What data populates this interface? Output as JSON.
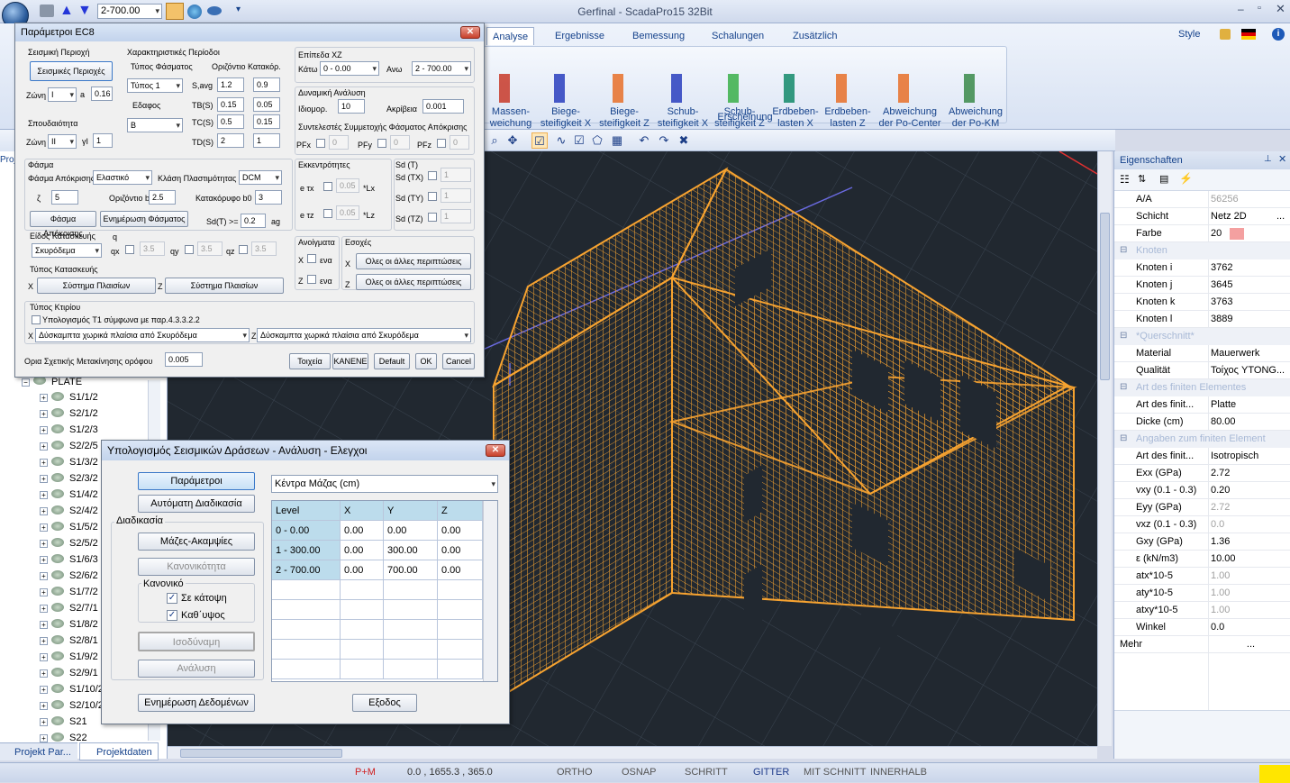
{
  "window": {
    "title": "Gerfinal - ScadaPro15 32Bit",
    "quick_value": "2-700.00"
  },
  "ribbon": {
    "tabs": [
      "Analyse",
      "Ergebnisse",
      "Bemessung",
      "Schalungen",
      "Zusätzlich"
    ],
    "style_label": "Style",
    "group_label": "Erscheinung",
    "buttons": [
      {
        "line1": "Massen-",
        "line2": "weichung"
      },
      {
        "line1": "Biege-",
        "line2": "steifigkeit X"
      },
      {
        "line1": "Biege-",
        "line2": "steifigkeit Z"
      },
      {
        "line1": "Schub-",
        "line2": "steifigkeit X"
      },
      {
        "line1": "Schub-",
        "line2": "steifigkeit Z"
      },
      {
        "line1": "Erdbeben-",
        "line2": "lasten X"
      },
      {
        "line1": "Erdbeben-",
        "line2": "lasten Z"
      },
      {
        "line1": "Abweichung",
        "line2": "der Po-Center"
      },
      {
        "line1": "Abweichung",
        "line2": "der Po-KM"
      }
    ]
  },
  "colors": {
    "accent": "#15428b",
    "mesh": "#f7a330",
    "viewport": "#212830",
    "highlight": "#bcdcec"
  },
  "ec8": {
    "title": "Παράμετροι EC8",
    "seismic_zone_label": "Σεισμική Περιοχή",
    "seismic_zones_btn": "Σεισμικές Περιοχές",
    "zone_label": "Ζώνη",
    "zone_value": "I",
    "a_label": "a",
    "a_value": "0.16",
    "importance_label": "Σπουδαιότητα",
    "zone2_label": "Ζώνη",
    "zone2_value": "II",
    "gi_label": "γΙ",
    "gi_value": "1",
    "period_char_label": "Χαρακτηριστικές Περίοδοι",
    "spectrum_type_label": "Τύπος Φάσματος",
    "horizontal_label": "Οριζόντιο",
    "vertical_label": "Κατακόρ.",
    "spectrum_type_value": "Τύπος 1",
    "savg_label": "S,avg",
    "savg_h": "1.2",
    "savg_v": "0.9",
    "soil_label": "Εδαφος",
    "soil_value": "B",
    "tb_label": "TB(S)",
    "tb_h": "0.15",
    "tb_v": "0.05",
    "tc_label": "TC(S)",
    "tc_h": "0.5",
    "tc_v": "0.15",
    "td_label": "TD(S)",
    "td_h": "2",
    "td_v": "1",
    "levels_label": "Επίπεδα XZ",
    "below_label": "Κάτω",
    "below_value": "0 - 0.00",
    "above_label": "Ανω",
    "above_value": "2 - 700.00",
    "dyn_label": "Δυναμική Ανάλυση",
    "eigen_label": "Ιδιομορ.",
    "eigen_value": "10",
    "accuracy_label": "Ακρίβεια",
    "accuracy_value": "0.001",
    "participation_label": "Συντελεστές Συμμετοχής Φάσματος Απόκρισης",
    "pfx_label": "PFx",
    "pfy_label": "PFy",
    "pfz_label": "PFz",
    "pf_value": "0",
    "spectrum_label": "Φάσμα",
    "response_spectrum_label": "Φάσμα Απόκρισης",
    "response_spectrum_value": "Ελαστικό",
    "ductility_label": "Κλάση Πλαστιμότητας",
    "ductility_value": "DCM",
    "zeta_label": "ζ",
    "zeta_value": "5",
    "horiz_b0_label": "Οριζόντιο b0",
    "horiz_b0_value": "2.5",
    "vert_b0_label": "Κατακόρυφο b0",
    "vert_b0_value": "3",
    "spectrum_btn": "Φάσμα Απόκρισης",
    "update_spectrum_btn": "Ενημέρωση Φάσματος",
    "sdt_label": "Sd(T) >=",
    "sdt_value": "0.2",
    "ag_label": "ag",
    "construction_label": "Είδος Κατασκευής",
    "construction_value": "Σκυρόδεμα",
    "q_label": "q",
    "qx_label": "qx",
    "qy_label": "qy",
    "qz_label": "qz",
    "q_value": "3.5",
    "construction_type_label": "Τύπος Κατασκευής",
    "x_label": "X",
    "z_label": "Z",
    "frame_system_btn": "Σύστημα Πλαισίων",
    "ecc_label": "Εκκεντρότητες",
    "etx_label": "e τx",
    "etz_label": "e τz",
    "ecc_value": "0.05",
    "lx_label": "*Lx",
    "lz_label": "*Lz",
    "sdt2_label": "Sd (T)",
    "sdtx_label": "Sd (TX)",
    "sdty_label": "Sd (TY)",
    "sdtz_label": "Sd (TZ)",
    "sd_value": "1",
    "openings_label": "Ανοίγματα",
    "openings_opt": "ενα",
    "setbacks_label": "Εσοχές",
    "all_cases_btn": "Ολες οι άλλες περιπτώσεις",
    "building_type_label": "Τύπος Κτιρίου",
    "t1_label": "Υπολογισμός T1 σύμφωνα με παρ.4.3.3.2.2",
    "bldg_x_value": "Δύσκαμπτα χωρικά πλαίσια από Σκυρόδεμα",
    "bldg_z_value": "Δύσκαμπτα χωρικά πλαίσια από Σκυρόδεμα",
    "drift_label": "Ορια Σχετικής Μετακίνησης ορόφου",
    "drift_value": "0.005",
    "btn_walls": "Τοιχεία",
    "btn_none": "ΚΑΝΕΝΕ",
    "btn_default": "Default",
    "btn_ok": "OK",
    "btn_cancel": "Cancel"
  },
  "seismic": {
    "title": "Υπολογισμός Σεισμικών Δράσεων - Ανάλυση - Ελεγχοι",
    "params_btn": "Παράμετροι",
    "auto_btn": "Αυτόματη Διαδικασία",
    "procedure_label": "Διαδικασία",
    "mass_btn": "Μάζες-Ακαμψίες",
    "normality_btn": "Κανονικότητα",
    "regular_label": "Κανονικό",
    "plan_label": "Σε κάτοψη",
    "height_label": "Καθ΄υψος",
    "equiv_btn": "Ισοδύναμη",
    "analysis_btn": "Ανάλυση",
    "update_btn": "Ενημέρωση Δεδομένων",
    "exit_btn": "Εξοδος",
    "dropdown_value": "Κέντρα Μάζας (cm)",
    "columns": [
      "Level",
      "X",
      "Y",
      "Z"
    ],
    "rows": [
      [
        "0 - 0.00",
        "0.00",
        "0.00",
        "0.00"
      ],
      [
        "1 - 300.00",
        "0.00",
        "300.00",
        "0.00"
      ],
      [
        "2 - 700.00",
        "0.00",
        "700.00",
        "0.00"
      ]
    ]
  },
  "tree": {
    "root": "PLATE",
    "items": [
      "S1/1/2",
      "S2/1/2",
      "S1/2/3",
      "S2/2/5",
      "S1/3/2",
      "S2/3/2",
      "S1/4/2",
      "S2/4/2",
      "S1/5/2",
      "S2/5/2",
      "S1/6/3",
      "S2/6/2",
      "S1/7/2",
      "S2/7/1",
      "S1/8/2",
      "S2/8/1",
      "S1/9/2",
      "S2/9/1",
      "S1/10/2",
      "S2/10/2",
      "S21",
      "S22"
    ],
    "tab1": "Projekt Par...",
    "tab2": "Projektdaten",
    "pane_label": "Proj"
  },
  "props": {
    "title": "Eigenschaften",
    "rows_top": [
      [
        "A/A",
        "56256",
        true
      ],
      [
        "Schicht",
        "Netz 2D",
        false
      ],
      [
        "Farbe",
        "20",
        false
      ]
    ],
    "cat_knoten": "Knoten",
    "knoten": [
      [
        "Knoten i",
        "3762"
      ],
      [
        "Knoten j",
        "3645"
      ],
      [
        "Knoten k",
        "3763"
      ],
      [
        "Knoten l",
        "3889"
      ]
    ],
    "cat_quer": "*Querschnitt*",
    "quer": [
      [
        "Material",
        "Mauerwerk"
      ],
      [
        "Qualität",
        "Τοίχος YTONG..."
      ]
    ],
    "cat_art": "Art des finiten Elementes",
    "art": [
      [
        "Art des finit...",
        "Platte"
      ],
      [
        "Dicke (cm)",
        "80.00"
      ]
    ],
    "cat_angaben": "Angaben zum finiten Element",
    "angaben": [
      [
        "Art des finit...",
        "Isotropisch",
        false
      ],
      [
        "Exx (GPa)",
        "2.72",
        false
      ],
      [
        "vxy (0.1 - 0.3)",
        "0.20",
        false
      ],
      [
        "Eyy (GPa)",
        "2.72",
        true
      ],
      [
        "vxz (0.1 - 0.3)",
        "0.0",
        true
      ],
      [
        "Gxy (GPa)",
        "1.36",
        false
      ],
      [
        "ε (kN/m3)",
        "10.00",
        false
      ],
      [
        "atx*10-5",
        "1.00",
        true
      ],
      [
        "aty*10-5",
        "1.00",
        true
      ],
      [
        "atxy*10-5",
        "1.00",
        true
      ],
      [
        "Winkel",
        "0.0",
        false
      ]
    ],
    "mehr": "Mehr",
    "ellipsis": "...",
    "color_swatch": "#f4a0a0"
  },
  "status": {
    "pm": "P+M",
    "coords": "0.0 , 1655.3 , 365.0",
    "ortho": "ORTHO",
    "osnap": "OSNAP",
    "schritt": "SCHRITT",
    "gitter": "GITTER",
    "mitschnitt": "MIT SCHNITT",
    "innerhalb": "INNERHALB"
  }
}
